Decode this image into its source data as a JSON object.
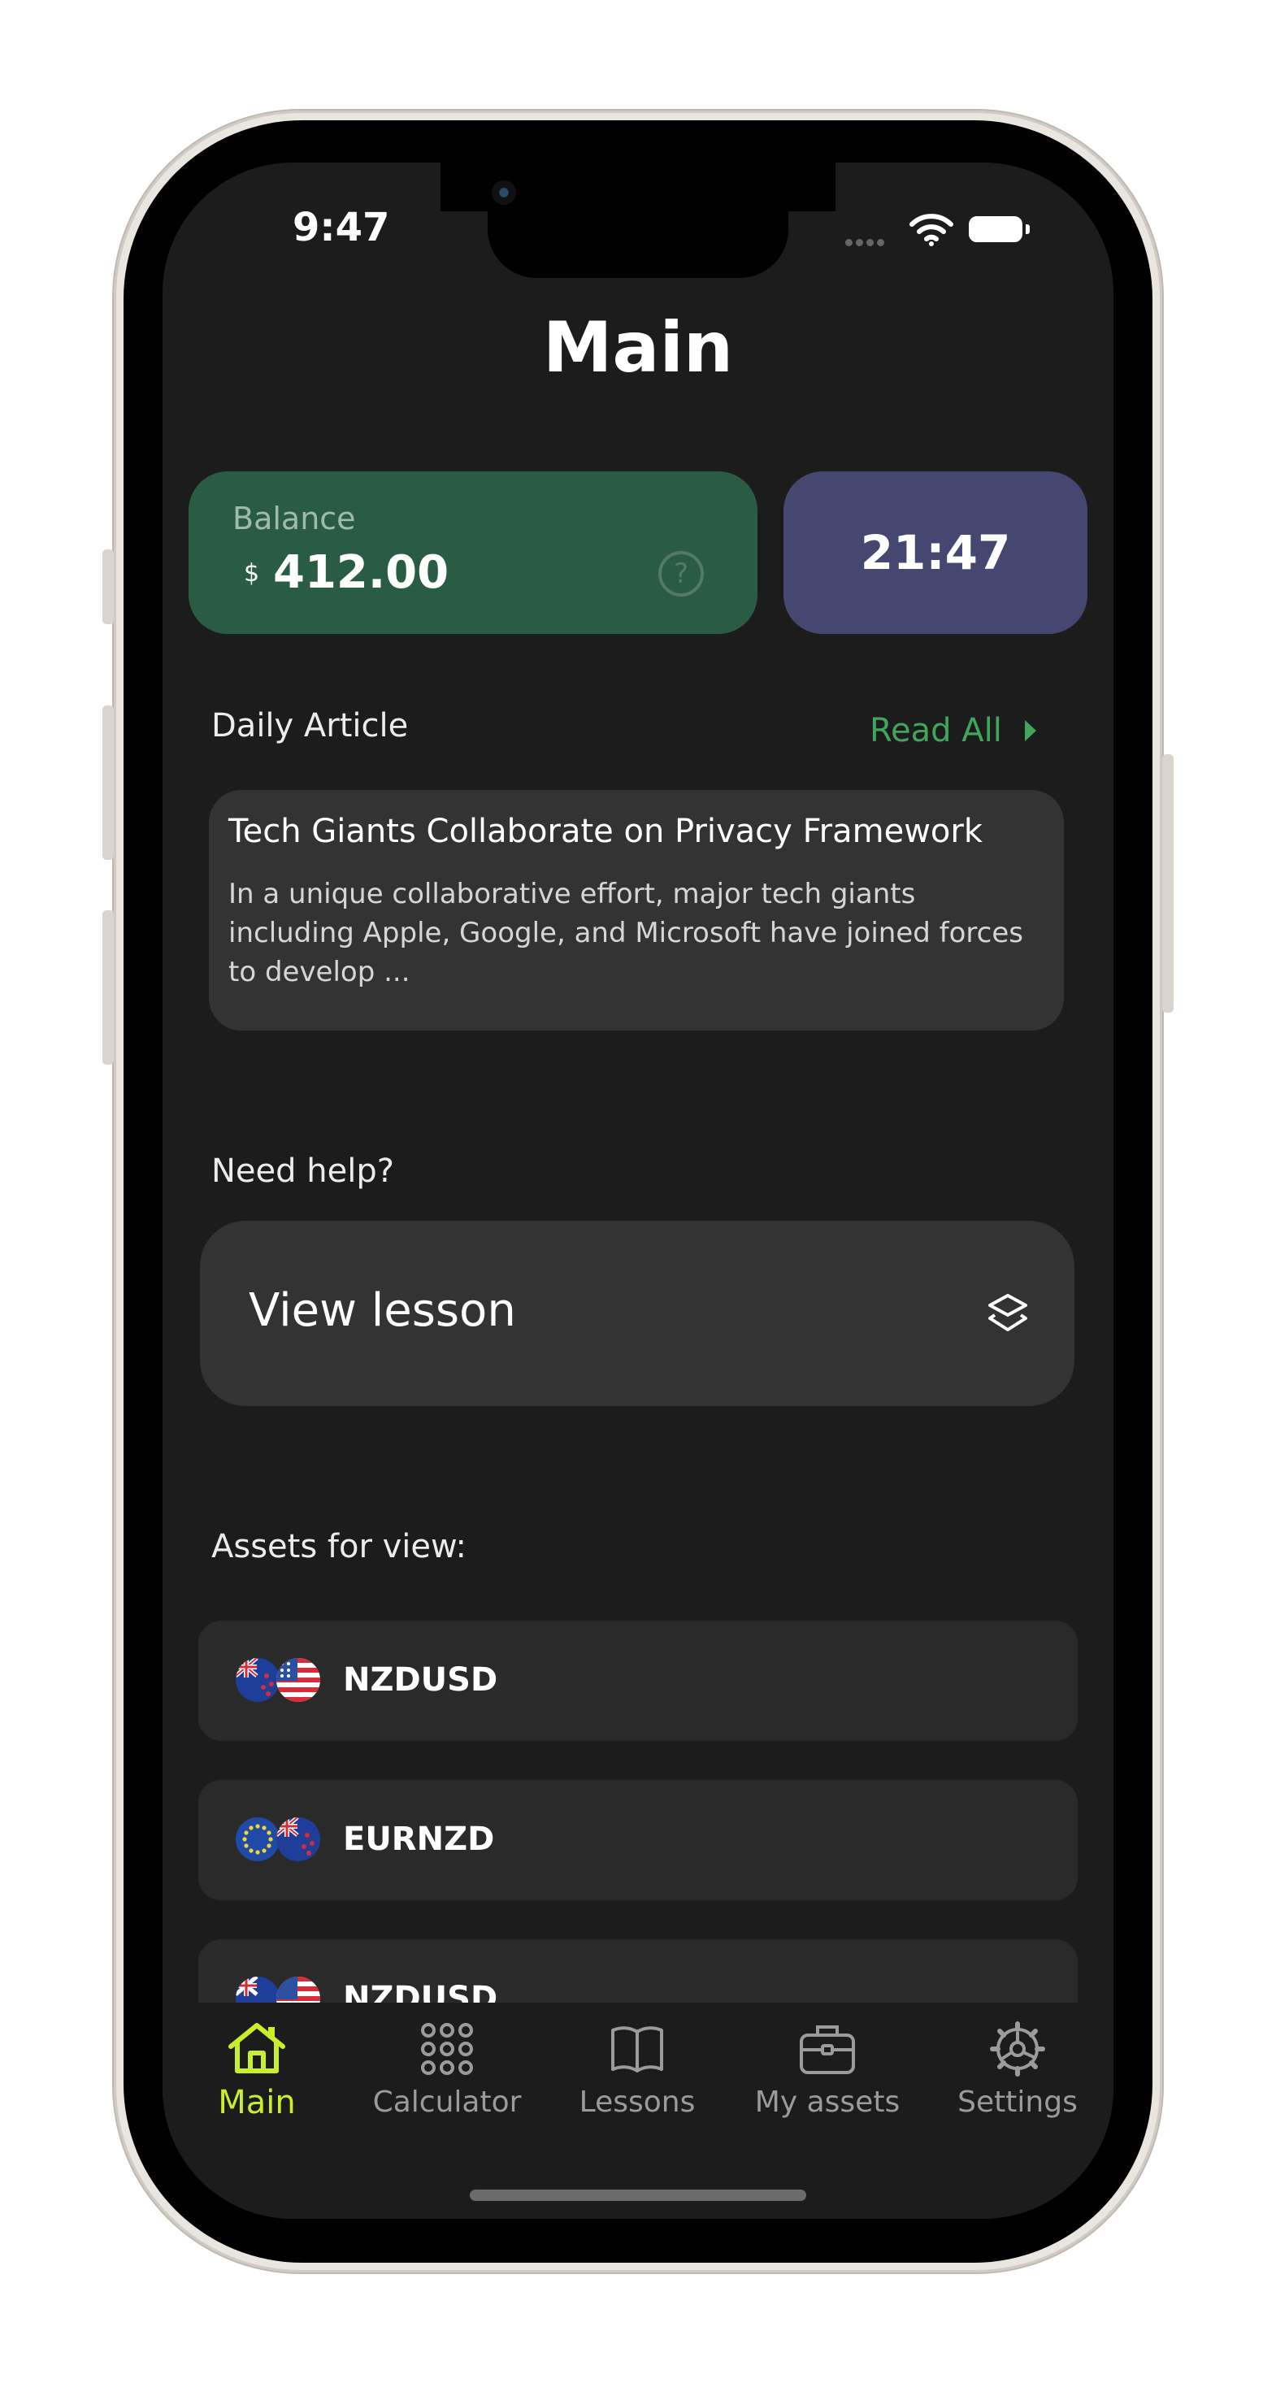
{
  "status_bar": {
    "time": "9:47"
  },
  "header": {
    "title": "Main"
  },
  "balance": {
    "label": "Balance",
    "currency": "$",
    "value": "412.00",
    "help_symbol": "?"
  },
  "clock": {
    "time": "21:47"
  },
  "daily_article": {
    "section_label": "Daily Article",
    "read_all_label": "Read All",
    "title": "Tech Giants Collaborate on Privacy Framework",
    "excerpt": "In a unique collaborative effort, major tech giants including Apple, Google, and Microsoft have joined forces to develop ..."
  },
  "help": {
    "section_label": "Need help?",
    "lesson_button_label": "View lesson"
  },
  "assets": {
    "section_label": "Assets for view:",
    "items": [
      {
        "name": "NZDUSD",
        "flags": [
          "nz-flag-icon",
          "us-flag-icon"
        ]
      },
      {
        "name": "EURNZD",
        "flags": [
          "eu-flag-icon",
          "nz-flag-icon"
        ]
      },
      {
        "name": "NZDUSD",
        "flags": [
          "nz-flag-icon",
          "us-flag-icon"
        ]
      }
    ]
  },
  "tab_bar": {
    "items": [
      {
        "label": "Main",
        "icon": "home-icon",
        "active": true
      },
      {
        "label": "Calculator",
        "icon": "grid-icon",
        "active": false
      },
      {
        "label": "Lessons",
        "icon": "book-icon",
        "active": false
      },
      {
        "label": "My assets",
        "icon": "briefcase-icon",
        "active": false
      },
      {
        "label": "Settings",
        "icon": "gear-icon",
        "active": false
      }
    ]
  },
  "colors": {
    "background": "#1c1c1c",
    "balance_card": "#2a5c45",
    "clock_card": "#454771",
    "card": "#333333",
    "asset_row": "#2a2a2a",
    "accent_green": "#3fa65c",
    "active_tab": "#c8ef2a",
    "inactive_tab": "#9b9b9b"
  }
}
